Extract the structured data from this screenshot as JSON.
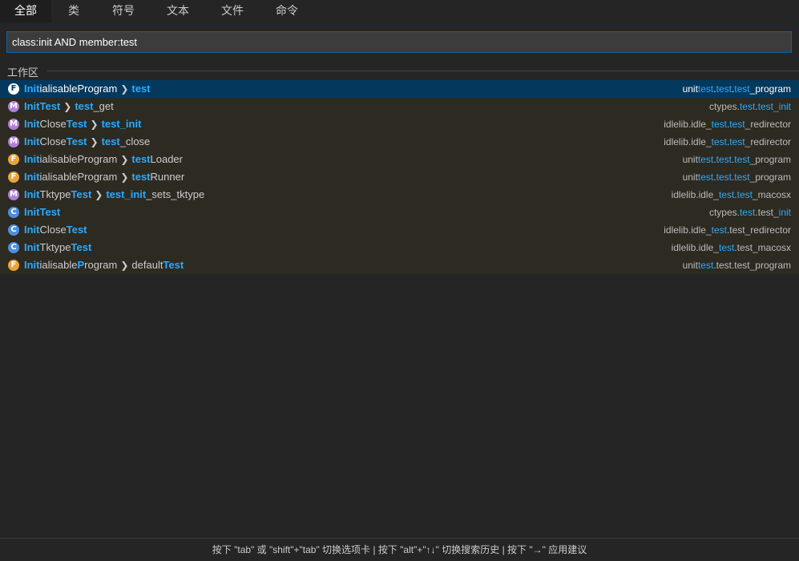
{
  "tabs": [
    {
      "label": "全部",
      "active": true
    },
    {
      "label": "类",
      "active": false
    },
    {
      "label": "符号",
      "active": false
    },
    {
      "label": "文本",
      "active": false
    },
    {
      "label": "文件",
      "active": false
    },
    {
      "label": "命令",
      "active": false
    }
  ],
  "search": {
    "value": "class:init AND member:test",
    "placeholder": ""
  },
  "group_label": "工作区",
  "results": [
    {
      "icon": "F",
      "selected": true,
      "name": [
        [
          "Init",
          true
        ],
        [
          "ialisableProgram",
          false
        ]
      ],
      "member": [
        [
          "test",
          true
        ]
      ],
      "desc": [
        [
          "unit",
          false
        ],
        [
          "test",
          true
        ],
        [
          ".",
          false
        ],
        [
          "test",
          true
        ],
        [
          ".",
          false
        ],
        [
          "test",
          true
        ],
        [
          "_program",
          false
        ]
      ]
    },
    {
      "icon": "M",
      "selected": false,
      "name": [
        [
          "InitTest",
          true
        ]
      ],
      "member": [
        [
          "test",
          true
        ],
        [
          "_get",
          false
        ]
      ],
      "desc": [
        [
          "ctypes.",
          false
        ],
        [
          "test",
          true
        ],
        [
          ".",
          false
        ],
        [
          "test_init",
          true
        ]
      ]
    },
    {
      "icon": "M",
      "selected": false,
      "name": [
        [
          "Init",
          true
        ],
        [
          "Close",
          false
        ],
        [
          "Test",
          true
        ]
      ],
      "member": [
        [
          "test_init",
          true
        ]
      ],
      "desc": [
        [
          "idlelib.idle_",
          false
        ],
        [
          "test",
          true
        ],
        [
          ".",
          false
        ],
        [
          "test",
          true
        ],
        [
          "_redirector",
          false
        ]
      ]
    },
    {
      "icon": "M",
      "selected": false,
      "name": [
        [
          "Init",
          true
        ],
        [
          "Close",
          false
        ],
        [
          "Test",
          true
        ]
      ],
      "member": [
        [
          "test",
          true
        ],
        [
          "_close",
          false
        ]
      ],
      "desc": [
        [
          "idlelib.idle_",
          false
        ],
        [
          "test",
          true
        ],
        [
          ".",
          false
        ],
        [
          "test",
          true
        ],
        [
          "_redirector",
          false
        ]
      ]
    },
    {
      "icon": "F",
      "selected": false,
      "name": [
        [
          "Init",
          true
        ],
        [
          "ialisableProgram",
          false
        ]
      ],
      "member": [
        [
          "test",
          true
        ],
        [
          "Loader",
          false
        ]
      ],
      "desc": [
        [
          "unit",
          false
        ],
        [
          "test",
          true
        ],
        [
          ".",
          false
        ],
        [
          "test",
          true
        ],
        [
          ".",
          false
        ],
        [
          "test",
          true
        ],
        [
          "_program",
          false
        ]
      ]
    },
    {
      "icon": "F",
      "selected": false,
      "name": [
        [
          "Init",
          true
        ],
        [
          "ialisableProgram",
          false
        ]
      ],
      "member": [
        [
          "test",
          true
        ],
        [
          "Runner",
          false
        ]
      ],
      "desc": [
        [
          "unit",
          false
        ],
        [
          "test",
          true
        ],
        [
          ".",
          false
        ],
        [
          "test",
          true
        ],
        [
          ".",
          false
        ],
        [
          "test",
          true
        ],
        [
          "_program",
          false
        ]
      ]
    },
    {
      "icon": "M",
      "selected": false,
      "name": [
        [
          "Init",
          true
        ],
        [
          "Tktype",
          false
        ],
        [
          "Test",
          true
        ]
      ],
      "member": [
        [
          "test_init",
          true
        ],
        [
          "_sets_tktype",
          false
        ]
      ],
      "desc": [
        [
          "idlelib.idle_",
          false
        ],
        [
          "test",
          true
        ],
        [
          ".",
          false
        ],
        [
          "test",
          true
        ],
        [
          "_macosx",
          false
        ]
      ]
    },
    {
      "icon": "C",
      "selected": false,
      "name": [
        [
          "InitTest",
          true
        ]
      ],
      "member": [],
      "desc": [
        [
          "ctypes.",
          false
        ],
        [
          "test",
          true
        ],
        [
          ".test_",
          false
        ],
        [
          "init",
          true
        ]
      ]
    },
    {
      "icon": "C",
      "selected": false,
      "name": [
        [
          "Init",
          true
        ],
        [
          "Close",
          false
        ],
        [
          "Test",
          true
        ]
      ],
      "member": [],
      "desc": [
        [
          "idlelib.idle_",
          false
        ],
        [
          "test",
          true
        ],
        [
          ".test_redirector",
          false
        ]
      ]
    },
    {
      "icon": "C",
      "selected": false,
      "name": [
        [
          "Init",
          true
        ],
        [
          "Tktype",
          false
        ],
        [
          "Test",
          true
        ]
      ],
      "member": [],
      "desc": [
        [
          "idlelib.idle_",
          false
        ],
        [
          "test",
          true
        ],
        [
          ".test_macosx",
          false
        ]
      ]
    },
    {
      "icon": "F",
      "selected": false,
      "name": [
        [
          "Init",
          true
        ],
        [
          "ialisable",
          false
        ],
        [
          "P",
          true
        ],
        [
          "rogram",
          false
        ]
      ],
      "member": [
        [
          "default",
          false
        ],
        [
          "Test",
          true
        ]
      ],
      "desc": [
        [
          "unit",
          false
        ],
        [
          "test",
          true
        ],
        [
          ".test.test_program",
          false
        ]
      ]
    }
  ],
  "separator": "❯",
  "footer": "按下 \"tab\" 或 \"shift\"+\"tab\" 切换选项卡 | 按下 \"alt\"+\"↑↓\" 切换搜索历史 | 按下 \"→\" 应用建议",
  "colors": {
    "highlight": "#2aaaff",
    "selected_row": "#04395e",
    "row_bg": "#2d2a22",
    "icon_function": "#e8a33d",
    "icon_method": "#b180d7",
    "icon_class": "#4c8fe0"
  }
}
